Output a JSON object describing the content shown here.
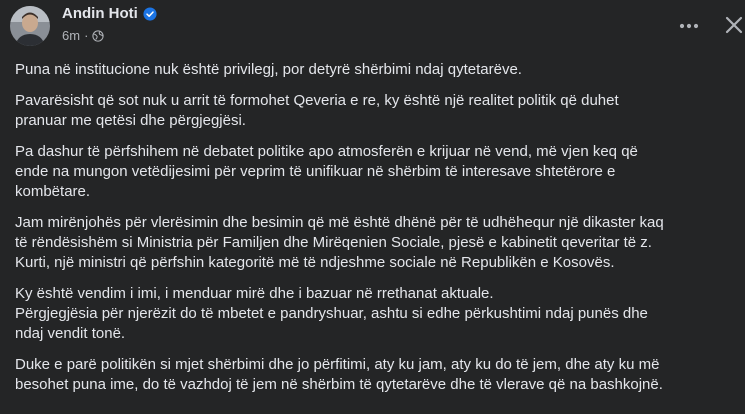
{
  "post": {
    "author_name": "Andin Hoti",
    "timestamp": "6m",
    "separator": "·",
    "icons": {
      "verified": "verified-badge-icon",
      "audience": "globe-icon",
      "more": "more-options-icon",
      "close": "close-icon"
    },
    "colors": {
      "background": "#242526",
      "text": "#e4e6eb",
      "secondary_text": "#b0b3b8",
      "verified_badge": "#1b74e4"
    },
    "paragraphs": [
      "Puna në institucione nuk është privilegj, por detyrë shërbimi ndaj qytetarëve.",
      "Pavarësisht që sot nuk u arrit të formohet Qeveria e re, ky është një realitet politik që duhet\npranuar me qetësi dhe përgjegjësi.",
      "Pa dashur të përfshihem në debatet politike apo atmosferën e krijuar në vend, më vjen keq që\nende na mungon vetëdijesimi për veprim të unifikuar në shërbim të interesave shtetërore e\nkombëtare.",
      "Jam mirënjohës për vlerësimin dhe besimin që më është dhënë për të udhëhequr një dikaster kaq\ntë rëndësishëm si Ministria për Familjen dhe Mirëqenien Sociale, pjesë e kabinetit qeveritar të z.\nKurti, një ministri që përfshin kategoritë më të ndjeshme sociale në Republikën e Kosovës.",
      "Ky është vendim i imi, i menduar mirë dhe i bazuar në rrethanat aktuale.\nPërgjegjësia për njerëzit do të mbetet e pandryshuar, ashtu si edhe përkushtimi ndaj punës dhe\nndaj vendit tonë.",
      "Duke e parë politikën si mjet shërbimi dhe jo përfitimi, aty ku jam, aty ku do të jem, dhe aty ku më\nbesohet puna ime, do të vazhdoj të jem në shërbim të qytetarëve dhe të vlerave që na bashkojnë."
    ]
  }
}
